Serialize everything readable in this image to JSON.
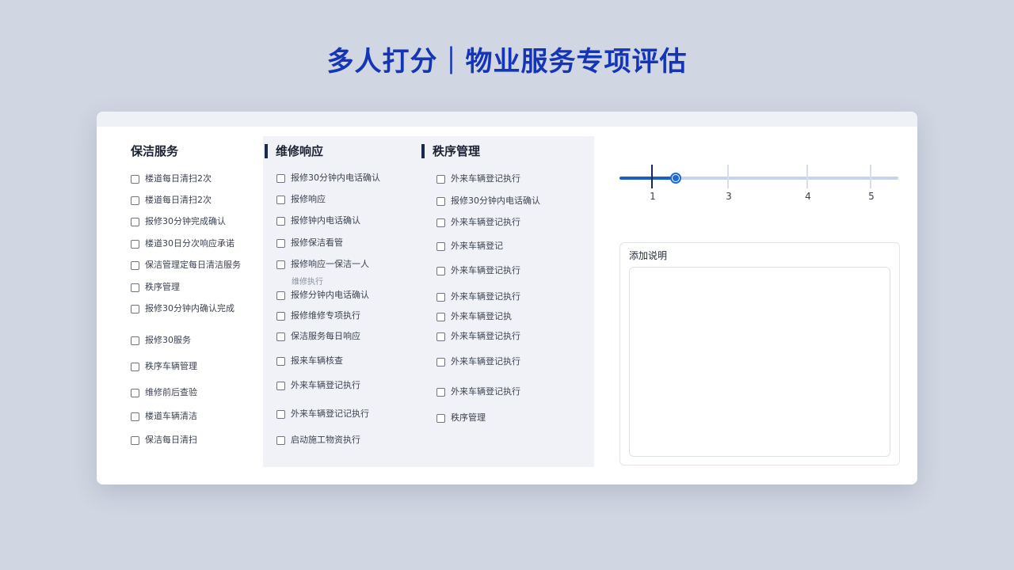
{
  "title": "多人打分｜物业服务专项评估",
  "columns": [
    {
      "heading": "保洁服务",
      "items": [
        "楼道每日清扫2次",
        "楼道每日清扫2次",
        "报修30分钟完成确认",
        "楼道30日分次响应承诺",
        "保洁管理定每日清洁服务",
        "秩序管理",
        "报修30分钟内确认完成",
        "报修30服务",
        "秩序车辆管理",
        "维修前后查验",
        "楼道车辆清洁",
        "保洁每日清扫"
      ]
    },
    {
      "heading": "维修响应",
      "note": "维修执行",
      "items": [
        "报修30分钟内电话确认",
        "报修响应",
        "报修钟内电话确认",
        "报修保洁看管",
        "报修响应一保洁一人",
        "报修分钟内电话确认",
        "报修维修专项执行",
        "保洁服务每日响应",
        "报来车辆核查",
        "外来车辆登记执行",
        "外来车辆登记记执行",
        "启动施工物资执行"
      ]
    },
    {
      "heading": "秩序管理",
      "items": [
        "外来车辆登记执行",
        "报修30分钟内电话确认",
        "外来车辆登记执行",
        "外来车辆登记",
        "外来车辆登记执行",
        "外来车辆登记执行",
        "外来车辆登记执",
        "外来车辆登记执行",
        "外来车辆登记执行",
        "外来车辆登记执行",
        "秩序管理"
      ]
    }
  ],
  "slider": {
    "value": 1,
    "ticks": [
      "1",
      "3",
      "4",
      "5"
    ],
    "accent": "#1b6ad8"
  },
  "note": {
    "label": "添加说明",
    "value": "",
    "placeholder": ""
  },
  "colors": {
    "title": "#1535b8",
    "background": "#d0d6e2",
    "card": "#ffffff",
    "column_panel": "#f0f2f7"
  }
}
